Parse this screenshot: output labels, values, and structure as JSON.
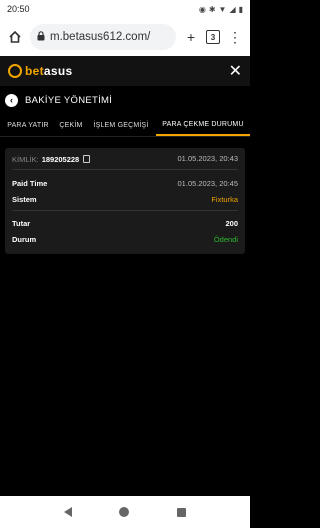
{
  "status_bar": {
    "time": "20:50",
    "icons": [
      "eye-icon",
      "bluetooth-icon",
      "wifi-icon",
      "signal-icon",
      "battery-icon"
    ]
  },
  "browser": {
    "url": "m.betasus612.com/",
    "tabs_count": "3"
  },
  "site": {
    "logo_b": "bet",
    "logo_rest": "asus"
  },
  "page": {
    "title": "BAKİYE YÖNETİMİ"
  },
  "tabs": [
    {
      "label": "PARA YATIR",
      "active": false
    },
    {
      "label": "ÇEKİM",
      "active": false
    },
    {
      "label": "İŞLEM GEÇMİŞİ",
      "active": false
    },
    {
      "label": "PARA ÇEKME DURUMU",
      "active": true
    }
  ],
  "record": {
    "id_label": "KİMLİK:",
    "id_value": "189205228",
    "created": "01.05.2023, 20:43",
    "paid_time_label": "Paid Time",
    "paid_time": "01.05.2023, 20:45",
    "system_label": "Sistem",
    "system": "Fixturka",
    "amount_label": "Tutar",
    "amount": "200",
    "status_label": "Durum",
    "status": "Ödendi"
  },
  "colors": {
    "accent": "#f0a500",
    "success": "#2eb82e",
    "background": "#000000",
    "card": "#1b1b1b"
  }
}
